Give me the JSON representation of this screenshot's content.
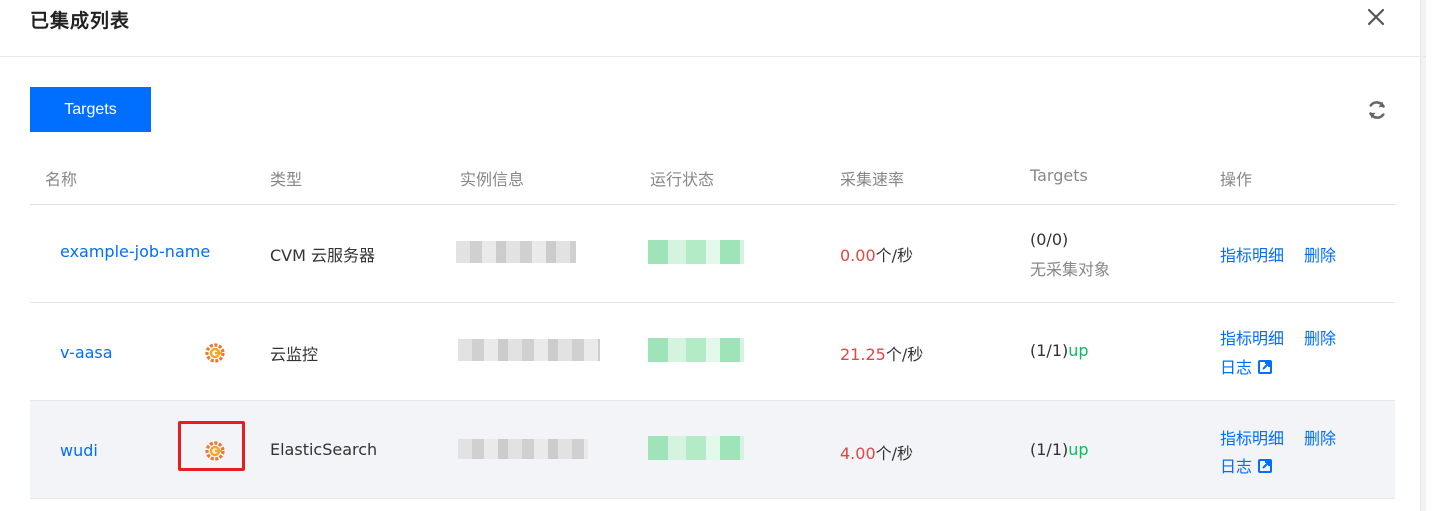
{
  "dialog": {
    "title": "已集成列表"
  },
  "toolbar": {
    "targets_button": "Targets"
  },
  "table": {
    "columns": [
      "名称",
      "类型",
      "实例信息",
      "运行状态",
      "采集速率",
      "Targets",
      "操作"
    ],
    "rows": [
      {
        "name": "example-job-name",
        "type": "CVM 云服务器",
        "rate_value": "0.00",
        "rate_unit": "个/秒",
        "targets_count": "(0/0)",
        "targets_note": "无采集对象",
        "action_metrics": "指标明细",
        "action_delete": "删除"
      },
      {
        "name": "v-aasa",
        "type": "云监控",
        "rate_value": "21.25",
        "rate_unit": "个/秒",
        "targets_count": "(1/1)",
        "targets_status": "up",
        "action_metrics": "指标明细",
        "action_delete": "删除",
        "action_log": "日志"
      },
      {
        "name": "wudi",
        "type": "ElasticSearch",
        "rate_value": "4.00",
        "rate_unit": "个/秒",
        "targets_count": "(1/1)",
        "targets_status": "up",
        "action_metrics": "指标明细",
        "action_delete": "删除",
        "action_log": "日志"
      }
    ]
  },
  "colors": {
    "accent": "#006eff",
    "rate": "#e54545",
    "up": "#0abf5b",
    "highlight": "#e51f1f",
    "grafana": "#f2752c"
  },
  "icons": [
    "close-icon",
    "refresh-icon",
    "grafana-icon",
    "external-link-icon"
  ]
}
